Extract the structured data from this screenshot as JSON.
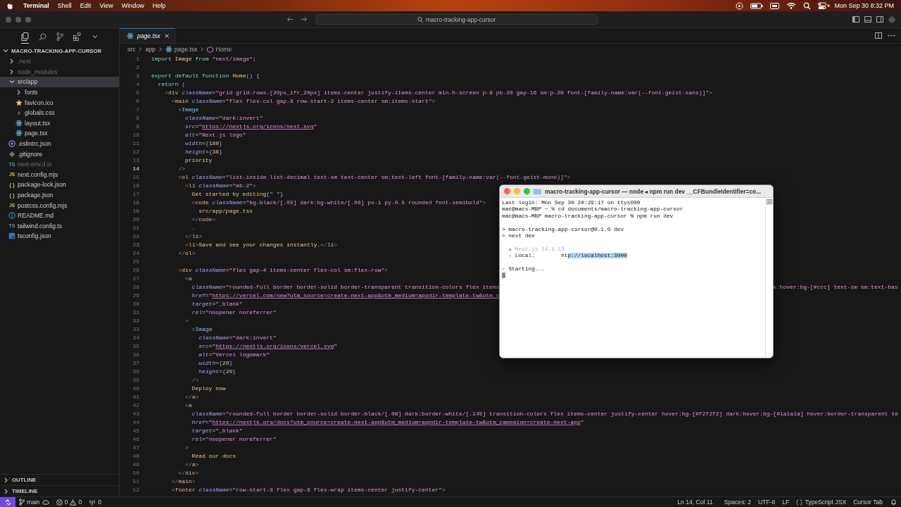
{
  "menubar": {
    "app": "Terminal",
    "menus": [
      "Shell",
      "Edit",
      "View",
      "Window",
      "Help"
    ],
    "clock": "Mon Sep 30  8:32 PM"
  },
  "titlebar": {
    "search": "macro-tracking-app-cursor"
  },
  "explorer": {
    "title": "MACRO-TRACKING-APP-CURSOR",
    "expanded": true,
    "items": [
      {
        "name": ".next",
        "kind": "folder",
        "expanded": false,
        "dimmed": true,
        "selected": false
      },
      {
        "name": "node_modules",
        "kind": "folder",
        "expanded": false,
        "dimmed": true,
        "selected": false
      },
      {
        "name": "src/app",
        "kind": "folder",
        "expanded": true,
        "dimmed": false,
        "selected": true,
        "children": [
          {
            "name": "fonts",
            "kind": "folder",
            "expanded": false,
            "dimmed": false,
            "selected": false
          },
          {
            "name": "favicon.ico",
            "kind": "star",
            "dimmed": false,
            "selected": false
          },
          {
            "name": "globals.css",
            "kind": "css",
            "badge": "#",
            "dimmed": false,
            "selected": false
          },
          {
            "name": "layout.tsx",
            "kind": "react",
            "dimmed": false,
            "selected": false
          },
          {
            "name": "page.tsx",
            "kind": "react",
            "dimmed": false,
            "selected": false
          }
        ]
      },
      {
        "name": ".eslintrc.json",
        "kind": "eslint",
        "dimmed": false,
        "selected": false
      },
      {
        "name": ".gitignore",
        "kind": "git",
        "dimmed": false,
        "selected": false
      },
      {
        "name": "next-env.d.ts",
        "kind": "ts",
        "badge": "TS",
        "dimmed": true,
        "selected": false
      },
      {
        "name": "next.config.mjs",
        "kind": "js",
        "badge": "JS",
        "dimmed": false,
        "selected": false
      },
      {
        "name": "package-lock.json",
        "kind": "json",
        "badge": "{ }",
        "dimmed": false,
        "selected": false
      },
      {
        "name": "package.json",
        "kind": "json",
        "badge": "{ }",
        "dimmed": false,
        "selected": false
      },
      {
        "name": "postcss.config.mjs",
        "kind": "js",
        "badge": "JS",
        "dimmed": false,
        "selected": false
      },
      {
        "name": "README.md",
        "kind": "info",
        "dimmed": false,
        "selected": false
      },
      {
        "name": "tailwind.config.ts",
        "kind": "ts",
        "badge": "TS",
        "dimmed": false,
        "selected": false
      },
      {
        "name": "tsconfig.json",
        "kind": "tsconfig",
        "dimmed": false,
        "selected": false
      }
    ]
  },
  "panels": [
    {
      "title": "OUTLINE",
      "expanded": false
    },
    {
      "title": "TIMELINE",
      "expanded": false
    }
  ],
  "editor": {
    "tabs": [
      {
        "label": "page.tsx",
        "selected": true,
        "preview": true
      }
    ],
    "breadcrumb": [
      "src",
      "app",
      "page.tsx",
      "Home"
    ],
    "lines": [
      {
        "n": "1",
        "current": false,
        "text": "import Image from \"next/image\";"
      },
      {
        "n": "2",
        "current": false
      },
      {
        "n": "3",
        "current": false,
        "text": "export default function Home() {"
      },
      {
        "n": "4",
        "current": false,
        "text": "  return ("
      },
      {
        "n": "5",
        "current": false,
        "text": "    <div className=\"grid grid-rows-[20px_1fr_20px] items-center justify-items-center min-h-screen p-8 pb-20 gap-16 sm:p-20 font-[family-name:var(--font-geist-sans)]\">"
      },
      {
        "n": "6",
        "current": false,
        "text": "      <main className=\"flex flex-col gap-8 row-start-2 items-center sm:items-start\">"
      },
      {
        "n": "7",
        "current": false,
        "text": "        <Image"
      },
      {
        "n": "8",
        "current": false,
        "text": "          className=\"dark:invert\""
      },
      {
        "n": "9",
        "current": false,
        "text": "          src=\"https://nextjs.org/icons/next.svg\""
      },
      {
        "n": "10",
        "current": false,
        "text": "          alt=\"Next.js logo\""
      },
      {
        "n": "11",
        "current": false,
        "text": "          width={180}"
      },
      {
        "n": "12",
        "current": false,
        "text": "          height={38}"
      },
      {
        "n": "13",
        "current": false,
        "text": "          priority"
      },
      {
        "n": "14",
        "current": true,
        "text": "        />"
      },
      {
        "n": "15",
        "current": false,
        "text": "        <ol className=\"list-inside list-decimal text-sm text-center sm:text-left font-[family-name:var(--font-geist-mono)]\">"
      },
      {
        "n": "16",
        "current": false,
        "text": "          <li className=\"mb-2\">"
      },
      {
        "n": "17",
        "current": false,
        "text": "            Get started by editing{\" \"}"
      },
      {
        "n": "18",
        "current": false,
        "text": "            <code className=\"bg-black/[.05] dark:bg-white/[.06] px-1 py-0.5 rounded font-semibold\">"
      },
      {
        "n": "19",
        "current": false,
        "text": "              src/app/page.tsx"
      },
      {
        "n": "20",
        "current": false,
        "text": "            </code>"
      },
      {
        "n": "21",
        "current": false,
        "text": "            ."
      },
      {
        "n": "22",
        "current": false,
        "text": "          </li>"
      },
      {
        "n": "23",
        "current": false,
        "text": "          <li>Save and see your changes instantly.</li>"
      },
      {
        "n": "24",
        "current": false,
        "text": "        </ol>"
      },
      {
        "n": "25",
        "current": false
      },
      {
        "n": "26",
        "current": false,
        "text": "        <div className=\"flex gap-4 items-center flex-col sm:flex-row\">"
      },
      {
        "n": "27",
        "current": false,
        "text": "          <a"
      },
      {
        "n": "28",
        "current": false,
        "text": "            className=\"rounded-full border border-solid border-transparent transition-colors flex items",
        "text_right": "k:hover:bg-[#ccc] text-sm sm:text-bas"
      },
      {
        "n": "29",
        "current": false,
        "text": "            href=\"https://vercel.com/new?utm_source=create-next-app&utm_medium=appdir-template-tw&utm_c"
      },
      {
        "n": "30",
        "current": false,
        "text": "            target=\"_blank\""
      },
      {
        "n": "31",
        "current": false,
        "text": "            rel=\"noopener noreferrer\""
      },
      {
        "n": "32",
        "current": false,
        "text": "          >"
      },
      {
        "n": "33",
        "current": false,
        "text": "            <Image"
      },
      {
        "n": "34",
        "current": false,
        "text": "              className=\"dark:invert\""
      },
      {
        "n": "35",
        "current": false,
        "text": "              src=\"https://nextjs.org/icons/vercel.svg\""
      },
      {
        "n": "36",
        "current": false,
        "text": "              alt=\"Vercel logomark\""
      },
      {
        "n": "37",
        "current": false,
        "text": "              width={20}"
      },
      {
        "n": "38",
        "current": false,
        "text": "              height={20}"
      },
      {
        "n": "39",
        "current": false,
        "text": "            />"
      },
      {
        "n": "40",
        "current": false,
        "text": "            Deploy now"
      },
      {
        "n": "41",
        "current": false,
        "text": "          </a>"
      },
      {
        "n": "42",
        "current": false,
        "text": "          <a"
      },
      {
        "n": "43",
        "current": false,
        "text": "            className=\"rounded-full border border-solid border-black/[.08] dark:border-white/[.145] transition-colors flex items-center justify-center hover:bg-[#f2f2f2] dark:hover:bg-[#1a1a1a] hover:border-transparent te"
      },
      {
        "n": "44",
        "current": false,
        "text": "            href=\"https://nextjs.org/docs?utm_source=create-next-app&utm_medium=appdir-template-tw&utm_campaign=create-next-app\""
      },
      {
        "n": "45",
        "current": false,
        "text": "            target=\"_blank\""
      },
      {
        "n": "46",
        "current": false,
        "text": "            rel=\"noopener noreferrer\""
      },
      {
        "n": "47",
        "current": false,
        "text": "          >"
      },
      {
        "n": "48",
        "current": false,
        "text": "            Read our docs"
      },
      {
        "n": "49",
        "current": false,
        "text": "          </a>"
      },
      {
        "n": "50",
        "current": false,
        "text": "        </div>"
      },
      {
        "n": "51",
        "current": false,
        "text": "      </main>"
      },
      {
        "n": "52",
        "current": false,
        "text": "      <footer className=\"row-start-3 flex gap-6 flex-wrap items-center justify-center\">"
      }
    ]
  },
  "terminal": {
    "title": "macro-tracking-app-cursor — node ◂ npm run dev __CFBundleIdentifier=co...",
    "lines": [
      {
        "kind": "plain",
        "text": "Last login: Mon Sep 30 20:29:17 on ttys000"
      },
      {
        "kind": "plain",
        "text": "mac@macs-MBP ~ % cd documents/macro-tracking-app-cursor"
      },
      {
        "kind": "plain",
        "text": "mac@macs-MBP macro-tracking-app-cursor % npm run dev"
      },
      {
        "kind": "blank"
      },
      {
        "kind": "plain",
        "text": "> macro-tracking-app-cursor@0.1.0 dev"
      },
      {
        "kind": "plain",
        "text": "> next dev"
      },
      {
        "kind": "blank"
      },
      {
        "kind": "dim",
        "text": "  ▲ Next.js 14.2.13"
      },
      {
        "kind": "selection",
        "text": "  - Local:        ht",
        "selected_text": "p://localhost:3000"
      },
      {
        "kind": "blank"
      },
      {
        "kind": "success",
        "mark": "✓",
        "text": " Starting..."
      },
      {
        "kind": "cursor"
      }
    ]
  },
  "statusbar": {
    "branch": "main",
    "errors": "0",
    "warnings": "0",
    "ports": "0",
    "right": [
      "Ln 14, Col 11",
      "Spaces: 2",
      "UTF-8",
      "LF",
      "TypeScript JSX",
      "Cursor Tab"
    ]
  }
}
